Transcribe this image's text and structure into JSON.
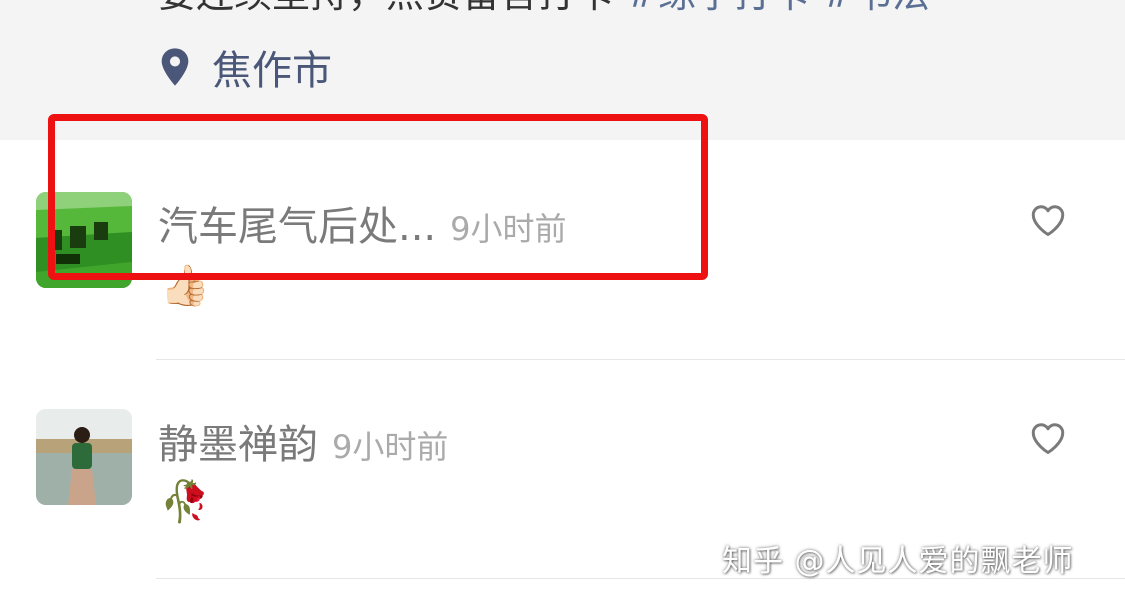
{
  "post": {
    "text": "要连续坚持，点赞留言打卡",
    "tags": "#练字打卡 #书法",
    "location": "焦作市"
  },
  "comments": [
    {
      "nickname": "汽车尾气后处...",
      "time": "9小时前",
      "emoji": "👍🏻",
      "like_icon": "heart-outline-icon"
    },
    {
      "nickname": "静墨禅韵",
      "time": "9小时前",
      "emoji": "🥀",
      "like_icon": "heart-outline-icon"
    }
  ],
  "watermark": "知乎 @人见人爱的飘老师",
  "colors": {
    "highlight": "#ee1111",
    "location": "#4a5778",
    "top_bg": "#f4f4f5"
  }
}
